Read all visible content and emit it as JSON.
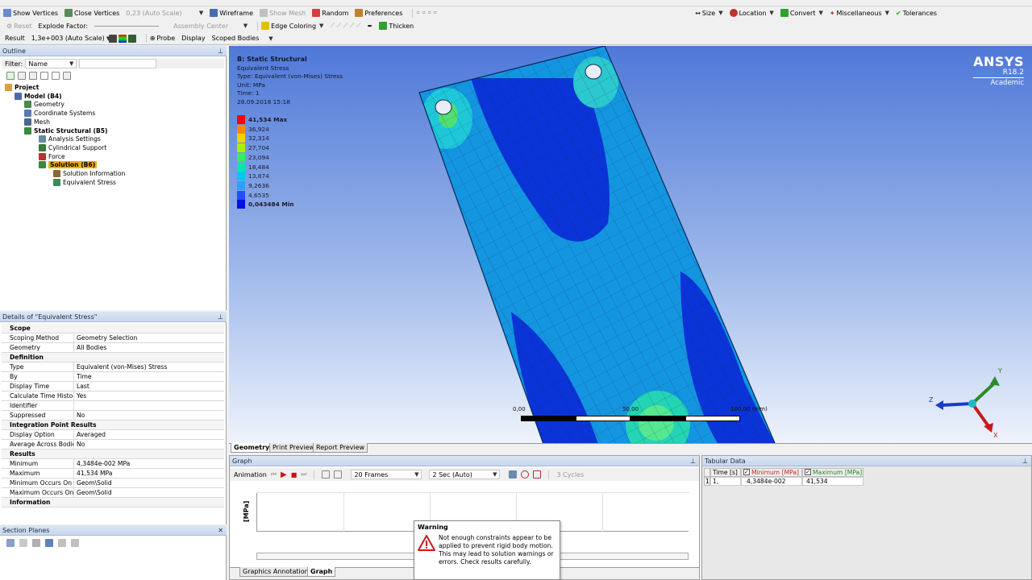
{
  "toolbar1": {
    "show_vertices": "Show Vertices",
    "close_vertices": "Close Vertices",
    "auto_scale_value": "0,23 (Auto Scale)",
    "wireframe": "Wireframe",
    "show_mesh": "Show Mesh",
    "random": "Random",
    "preferences": "Preferences",
    "size": "Size",
    "location": "Location",
    "convert": "Convert",
    "miscellaneous": "Miscellaneous",
    "tolerances": "Tolerances"
  },
  "toolbar2": {
    "reset": "Reset",
    "explode_factor": "Explode Factor:",
    "assembly_center": "Assembly Center",
    "edge_coloring": "Edge Coloring",
    "thicken": "Thicken"
  },
  "toolbar3": {
    "result": "Result",
    "scale_value": "1,3e+003 (Auto Scale)",
    "probe": "Probe",
    "display": "Display",
    "scoped_bodies": "Scoped Bodies"
  },
  "outline": {
    "title": "Outline",
    "filter_label": "Filter:",
    "filter_value": "Name",
    "tree": [
      {
        "label": "Project",
        "bold": true
      },
      {
        "label": "Model (B4)",
        "bold": true
      },
      {
        "label": "Geometry",
        "bold": false
      },
      {
        "label": "Coordinate Systems",
        "bold": false
      },
      {
        "label": "Mesh",
        "bold": false
      },
      {
        "label": "Static Structural (B5)",
        "bold": true
      },
      {
        "label": "Analysis Settings",
        "bold": false
      },
      {
        "label": "Cylindrical Support",
        "bold": false
      },
      {
        "label": "Force",
        "bold": false
      },
      {
        "label": "Solution (B6)",
        "bold": true
      },
      {
        "label": "Solution Information",
        "bold": false
      },
      {
        "label": "Equivalent Stress",
        "bold": false
      }
    ]
  },
  "details": {
    "title": "Details of \"Equivalent Stress\"",
    "rows": [
      {
        "group": "Scope"
      },
      {
        "k": "Scoping Method",
        "v": "Geometry Selection"
      },
      {
        "k": "Geometry",
        "v": "All Bodies"
      },
      {
        "group": "Definition"
      },
      {
        "k": "Type",
        "v": "Equivalent (von-Mises) Stress"
      },
      {
        "k": "By",
        "v": "Time"
      },
      {
        "k": "Display Time",
        "v": "Last"
      },
      {
        "k": "Calculate Time History",
        "v": "Yes"
      },
      {
        "k": "Identifier",
        "v": ""
      },
      {
        "k": "Suppressed",
        "v": "No"
      },
      {
        "group": "Integration Point Results"
      },
      {
        "k": "Display Option",
        "v": "Averaged"
      },
      {
        "k": "Average Across Bodies",
        "v": "No"
      },
      {
        "group": "Results"
      },
      {
        "k": "Minimum",
        "v": "4,3484e-002 MPa"
      },
      {
        "k": "Maximum",
        "v": "41,534 MPa"
      },
      {
        "k": "Minimum Occurs On",
        "v": "Geom\\Solid"
      },
      {
        "k": "Maximum Occurs On",
        "v": "Geom\\Solid"
      },
      {
        "group": "Information"
      }
    ]
  },
  "section_planes": {
    "title": "Section Planes"
  },
  "viewport": {
    "title": "B: Static Structural",
    "line1": "Equivalent Stress",
    "line2": "Type: Equivalent (von-Mises) Stress",
    "line3": "Unit: MPa",
    "line4": "Time: 1",
    "line5": "28.09.2018 15:18",
    "legend_max": "41,534 Max",
    "legend_values": [
      "36,924",
      "32,314",
      "27,704",
      "23,094",
      "18,484",
      "13,874",
      "9,2636",
      "4,6535"
    ],
    "legend_min": "0,043484 Min",
    "legend_colors": [
      "#ff0000",
      "#ff8a00",
      "#e8d800",
      "#a8f000",
      "#30f060",
      "#00e8b0",
      "#00c8f0",
      "#30a0ff",
      "#2050ff",
      "#0010e8"
    ],
    "brand": "ANSYS",
    "version": "R18.2",
    "edition": "Academic",
    "scale_0": "0,00",
    "scale_mid": "50,00",
    "scale_end": "100,00 (mm)",
    "tabs": [
      "Geometry",
      "Print Preview",
      "Report Preview"
    ]
  },
  "graph": {
    "title": "Graph",
    "animation": "Animation",
    "frames": "20 Frames",
    "duration": "2 Sec (Auto)",
    "cycles": "3 Cycles",
    "ylabel": "[MPa]",
    "tabs": [
      "Graphics Annotations",
      "Graph"
    ]
  },
  "tabular": {
    "title": "Tabular Data",
    "headers": [
      "Time [s]",
      "Minimum [MPa]",
      "Maximum [MPa]"
    ],
    "row": [
      "1",
      "1,",
      "4,3484e-002",
      "41,534"
    ]
  },
  "warning": {
    "title": "Warning",
    "message": "Not enough constraints appear to be applied to prevent rigid body motion. This may lead to solution warnings or errors. Check results carefully."
  }
}
